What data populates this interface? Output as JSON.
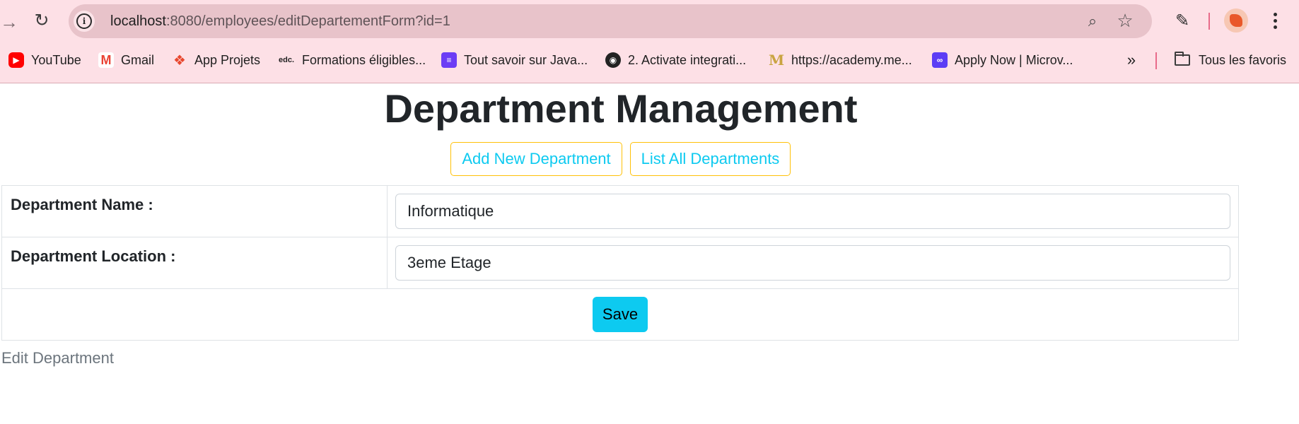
{
  "browser": {
    "url_host": "localhost",
    "url_path": ":8080/employees/editDepartementForm?id=1",
    "bookmarks": [
      {
        "label": "YouTube",
        "icon": "youtube-icon",
        "color": "#ff0000"
      },
      {
        "label": "Gmail",
        "icon": "gmail-icon",
        "color": "#ea4335"
      },
      {
        "label": "App Projets",
        "icon": "app-projets-icon",
        "color": "#e8472e"
      },
      {
        "label": "Formations éligibles...",
        "icon": "edc-icon",
        "color": "#222222"
      },
      {
        "label": "Tout savoir sur Java...",
        "icon": "purple-app-icon",
        "color": "#6b3df5"
      },
      {
        "label": "2. Activate integrati...",
        "icon": "globe-icon",
        "color": "#222222"
      },
      {
        "label": "https://academy.me...",
        "icon": "academy-m-icon",
        "color": "#c9a441"
      },
      {
        "label": "Apply Now | Microv...",
        "icon": "microv-icon",
        "color": "#5b3df5"
      }
    ],
    "all_bookmarks_label": "Tous les favoris"
  },
  "page": {
    "title": "Department Management",
    "add_button": "Add New Department",
    "list_button": "List All Departments",
    "form": {
      "name_label": "Department Name :",
      "name_value": "Informatique",
      "location_label": "Department Location :",
      "location_value": "3eme Etage",
      "save_label": "Save"
    },
    "footer": "Edit Department"
  },
  "colors": {
    "chrome_bg": "#fde0e6",
    "accent_info": "#0dcaf0",
    "outline_warning": "#ffc107"
  }
}
